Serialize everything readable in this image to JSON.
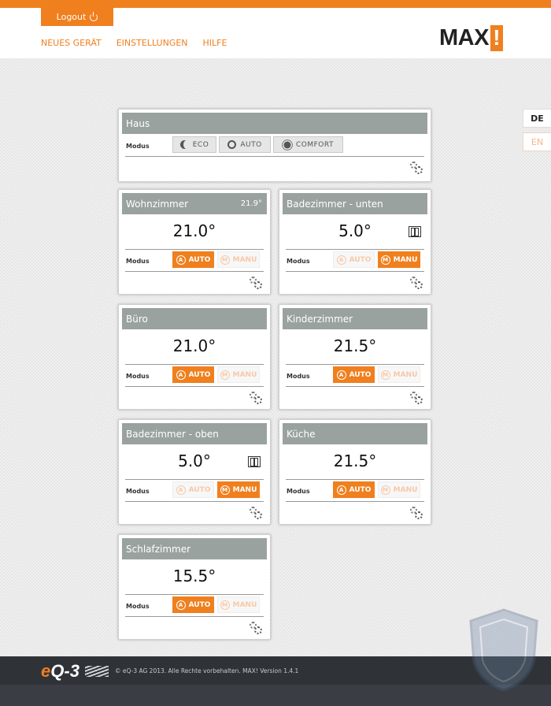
{
  "header": {
    "logout_label": "Logout",
    "nav": [
      "NEUES GERÄT",
      "EINSTELLUNGEN",
      "HILFE"
    ],
    "logo_text": "MAX",
    "logo_bang": "!"
  },
  "languages": [
    "DE",
    "EN"
  ],
  "haus": {
    "title": "Haus",
    "modus_label": "Modus",
    "buttons": [
      "ECO",
      "AUTO",
      "COMFORT"
    ]
  },
  "rooms": [
    {
      "name": "Wohnzimmer",
      "current": "21.9°",
      "setpoint": "21.0°",
      "mode": "AUTO",
      "window_open": false
    },
    {
      "name": "Badezimmer - unten",
      "current": "",
      "setpoint": "5.0°",
      "mode": "MANU",
      "window_open": true
    },
    {
      "name": "Büro",
      "current": "",
      "setpoint": "21.0°",
      "mode": "AUTO",
      "window_open": false
    },
    {
      "name": "Kinderzimmer",
      "current": "",
      "setpoint": "21.5°",
      "mode": "AUTO",
      "window_open": false
    },
    {
      "name": "Badezimmer - oben",
      "current": "",
      "setpoint": "5.0°",
      "mode": "MANU",
      "window_open": true
    },
    {
      "name": "Küche",
      "current": "",
      "setpoint": "21.5°",
      "mode": "AUTO",
      "window_open": false
    },
    {
      "name": "Schlafzimmer",
      "current": "",
      "setpoint": "15.5°",
      "mode": "AUTO",
      "window_open": false
    }
  ],
  "room_ui": {
    "modus_label": "Modus",
    "auto_label": "AUTO",
    "manu_label": "MANU"
  },
  "footer": {
    "brand_e": "e",
    "brand_q3": "Q-3",
    "copyright": "© eQ-3 AG 2013. Alle Rechte vorbehalten. MAX! Version 1.4.1"
  },
  "colors": {
    "accent": "#f07f1e",
    "card_header": "#9aa29f",
    "footer": "#3a3e44"
  }
}
